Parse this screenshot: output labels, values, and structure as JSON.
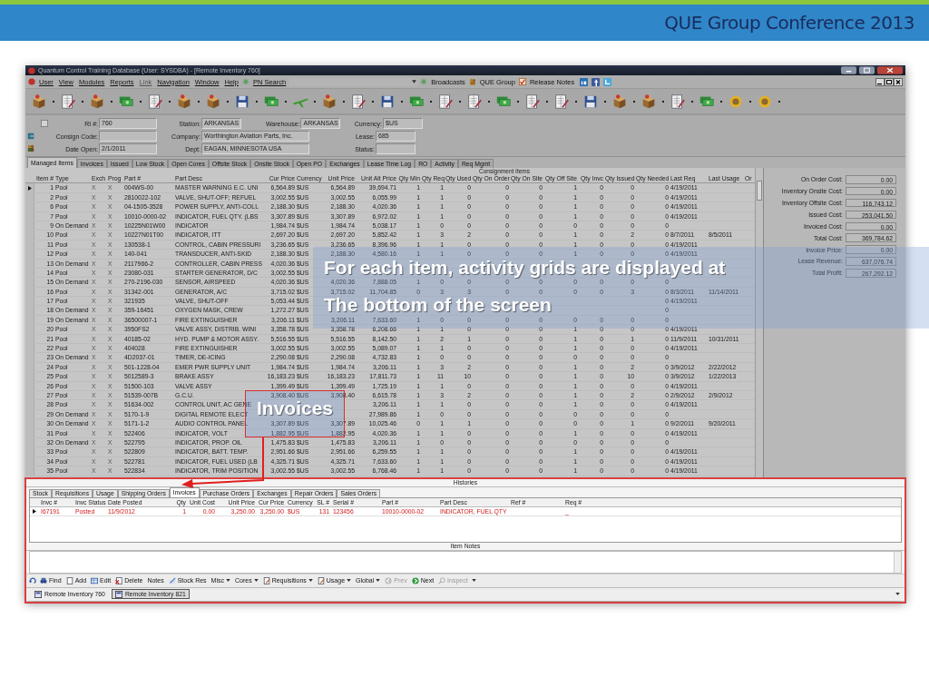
{
  "slide": {
    "title": "QUE Group Conference 2013"
  },
  "window": {
    "title": "Quantum Control Training Database (User: SYSDBA) - [Remote Inventory 760]",
    "menu": [
      {
        "label": "User",
        "disabled": false
      },
      {
        "label": "View",
        "disabled": false
      },
      {
        "label": "Modules",
        "disabled": false
      },
      {
        "label": "Reports",
        "disabled": false
      },
      {
        "label": "Link",
        "disabled": true
      },
      {
        "label": "Navigation",
        "disabled": false
      },
      {
        "label": "Window",
        "disabled": false
      },
      {
        "label": "Help",
        "disabled": false
      }
    ],
    "pn_search": "PN Search",
    "links": [
      "Broadcasts",
      "QUE Group",
      "Release Notes"
    ]
  },
  "form": {
    "checkbox": {
      "checked": false
    },
    "rows": [
      [
        {
          "label": "RI #:",
          "value": "760"
        },
        {
          "label": "Station:",
          "value": "ARKANSAS"
        },
        {
          "label": "Warehouse:",
          "value": "ARKANSAS"
        },
        {
          "label": "Currency:",
          "value": "$US"
        }
      ],
      [
        {
          "label": "Consign Code:"
        },
        {
          "label": "Company:",
          "value": "Worthington Aviation Parts, Inc."
        },
        {
          "label": "Lease:",
          "value": "685"
        }
      ],
      [
        {
          "label": "Date Open:",
          "value": "2/1/2011"
        },
        {
          "label": "Dept:",
          "value": "EAGAN, MINNESOTA USA"
        },
        {
          "label": "Status:"
        }
      ]
    ]
  },
  "tabs": [
    {
      "label": "Managed Items",
      "selected": true
    },
    {
      "label": "Invoices",
      "selected": false
    },
    {
      "label": "Issued",
      "selected": false
    },
    {
      "label": "Low Stock",
      "selected": false
    },
    {
      "label": "Open Cores",
      "selected": false
    },
    {
      "label": "Offsite Stock",
      "selected": false
    },
    {
      "label": "Onsite Stock",
      "selected": false
    },
    {
      "label": "Open PO",
      "selected": false
    },
    {
      "label": "Exchanges",
      "selected": false
    },
    {
      "label": "Lease Time Log",
      "selected": false
    },
    {
      "label": "RO",
      "selected": false
    },
    {
      "label": "Activity",
      "selected": false
    },
    {
      "label": "Req Mgmt",
      "selected": false
    }
  ],
  "grid": {
    "group_header": "Consignment Items",
    "columns": [
      "Item #",
      "Type",
      "Exch",
      "Prog",
      "Part #",
      "Part Desc",
      "Cur Price",
      "Currency",
      "Unit Price",
      "Unit Alt Price",
      "Qty Min",
      "Qty Req",
      "Qty Used",
      "Qty On Order",
      "Qty On Site",
      "Qty Off Site",
      "Qty Invc",
      "Qty Issued",
      "Qty Needed",
      "Last Req",
      "Last Usage",
      "Or"
    ],
    "rows": [
      {
        "selected": true,
        "cells": [
          "1",
          "Pool",
          "X",
          "X",
          "004WS-00",
          "MASTER WARNING E.C. UNI",
          "6,564.89",
          "$US",
          "6,564.89",
          "39,694.71",
          "1",
          "1",
          "0",
          "0",
          "0",
          "1",
          "0",
          "0",
          "0",
          "4/19/2011",
          null
        ]
      },
      {
        "selected": false,
        "cells": [
          "2",
          "Pool",
          "X",
          "X",
          "2810022-102",
          "VALVE, SHUT-OFF; REFUEL",
          "3,002.55",
          "$US",
          "3,002.55",
          "6,055.99",
          "1",
          "1",
          "0",
          "0",
          "0",
          "1",
          "0",
          "0",
          "0",
          "4/19/2011",
          null
        ]
      },
      {
        "selected": false,
        "cells": [
          "6",
          "Pool",
          "X",
          "X",
          "04-1505-3528",
          "POWER SUPPLY, ANTI-COLL",
          "2,188.30",
          "$US",
          "2,188.30",
          "4,020.36",
          "1",
          "1",
          "0",
          "0",
          "0",
          "1",
          "0",
          "0",
          "0",
          "4/19/2011",
          null
        ]
      },
      {
        "selected": false,
        "cells": [
          "7",
          "Pool",
          "X",
          "X",
          "10010-0000-02",
          "INDICATOR, FUEL QTY. (LBS",
          "3,307.89",
          "$US",
          "3,307.89",
          "6,972.02",
          "1",
          "1",
          "0",
          "0",
          "0",
          "1",
          "0",
          "0",
          "0",
          "4/19/2011",
          null
        ]
      },
      {
        "selected": false,
        "cells": [
          "9",
          "On Demand",
          "X",
          "X",
          "10225N01W00",
          "INDICATOR",
          "1,984.74",
          "$US",
          "1,984.74",
          "5,038.17",
          "1",
          "0",
          "0",
          "0",
          "0",
          "0",
          "0",
          "0",
          "0",
          null,
          null
        ]
      },
      {
        "selected": false,
        "cells": [
          "10",
          "Pool",
          "X",
          "X",
          "10227N01T00",
          "INDICATOR, ITT",
          "2,697.20",
          "$US",
          "2,697.20",
          "5,852.42",
          "1",
          "3",
          "2",
          "0",
          "0",
          "1",
          "0",
          "2",
          "0",
          "8/7/2011",
          "8/5/2011"
        ]
      },
      {
        "selected": false,
        "cells": [
          "11",
          "Pool",
          "X",
          "X",
          "130538-1",
          "CONTROL, CABIN PRESSURI",
          "3,236.65",
          "$US",
          "3,236.65",
          "8,396.96",
          "1",
          "1",
          "0",
          "0",
          "0",
          "1",
          "0",
          "0",
          "0",
          "4/19/2011",
          null
        ]
      },
      {
        "selected": false,
        "cells": [
          "12",
          "Pool",
          "X",
          "X",
          "140-041",
          "TRANSDUCER, ANTI-SKID",
          "2,188.30",
          "$US",
          "2,188.30",
          "4,580.16",
          "1",
          "1",
          "0",
          "0",
          "0",
          "1",
          "0",
          "0",
          "0",
          "4/19/2011",
          null
        ]
      },
      {
        "selected": false,
        "cells": [
          "13",
          "On Demand",
          "X",
          "X",
          "2117966-2",
          "CONTROLLER, CABIN PRESS",
          "4,020.36",
          "$US",
          null,
          null,
          null,
          null,
          null,
          null,
          null,
          null,
          null,
          null,
          null,
          null,
          null
        ]
      },
      {
        "selected": false,
        "cells": [
          "14",
          "Pool",
          "X",
          "X",
          "23080-031",
          "STARTER GENERATOR, D/C",
          "3,002.55",
          "$US",
          null,
          null,
          null,
          null,
          null,
          null,
          null,
          null,
          null,
          null,
          null,
          null,
          null
        ]
      },
      {
        "selected": false,
        "cells": [
          "15",
          "On Demand",
          "X",
          "X",
          "270-2196-030",
          "SENSOR, AIRSPEED",
          "4,020.36",
          "$US",
          "4,020.36",
          "7,888.05",
          "1",
          "0",
          "0",
          "0",
          "0",
          "0",
          "0",
          "0",
          "0",
          null,
          null
        ]
      },
      {
        "selected": false,
        "cells": [
          "16",
          "Pool",
          "X",
          "X",
          "31342-001",
          "GENERATOR, A/C",
          "3,715.02",
          "$US",
          "3,715.02",
          "11,704.85",
          "0",
          "3",
          "3",
          "0",
          "0",
          "0",
          "0",
          "3",
          "0",
          "8/3/2011",
          "11/14/2011"
        ]
      },
      {
        "selected": false,
        "cells": [
          "17",
          "Pool",
          "X",
          "X",
          "321935",
          "VALVE, SHUT-OFF",
          "5,053.44",
          "$US",
          null,
          null,
          null,
          null,
          null,
          null,
          null,
          null,
          null,
          null,
          "0",
          "4/19/2011",
          null
        ]
      },
      {
        "selected": false,
        "cells": [
          "18",
          "On Demand",
          "X",
          "X",
          "359-16451",
          "OXYGEN MASK, CREW",
          "1,272.27",
          "$US",
          null,
          null,
          null,
          null,
          null,
          null,
          null,
          null,
          null,
          null,
          "0",
          null,
          null
        ]
      },
      {
        "selected": false,
        "cells": [
          "19",
          "On Demand",
          "X",
          "X",
          "36500007-1",
          "FIRE EXTINGUISHER",
          "3,206.11",
          "$US",
          "3,206.11",
          "7,633.60",
          "1",
          "0",
          "0",
          "0",
          "0",
          "0",
          "0",
          "0",
          "0",
          null,
          null
        ]
      },
      {
        "selected": false,
        "cells": [
          "20",
          "Pool",
          "X",
          "X",
          "3950FS2",
          "VALVE ASSY,  DISTRIB. WINI",
          "3,358.78",
          "$US",
          "3,358.78",
          "6,208.66",
          "1",
          "1",
          "0",
          "0",
          "0",
          "1",
          "0",
          "0",
          "0",
          "4/19/2011",
          null
        ]
      },
      {
        "selected": false,
        "cells": [
          "21",
          "Pool",
          "X",
          "X",
          "40185-02",
          "HYD. PUMP & MOTOR ASSY.",
          "5,516.55",
          "$US",
          "5,516.55",
          "8,142.50",
          "1",
          "2",
          "1",
          "0",
          "0",
          "1",
          "0",
          "1",
          "0",
          "11/9/2011",
          "10/31/2011"
        ]
      },
      {
        "selected": false,
        "cells": [
          "22",
          "Pool",
          "X",
          "X",
          "404028",
          "FIRE EXTINGUISHER",
          "3,002.55",
          "$US",
          "3,002.55",
          "5,089.07",
          "1",
          "1",
          "0",
          "0",
          "0",
          "1",
          "0",
          "0",
          "0",
          "4/19/2011",
          null
        ]
      },
      {
        "selected": false,
        "cells": [
          "23",
          "On Demand",
          "X",
          "X",
          "4D2037-01",
          "TIMER, DE-ICING",
          "2,290.08",
          "$US",
          "2,290.08",
          "4,732.83",
          "1",
          "0",
          "0",
          "0",
          "0",
          "0",
          "0",
          "0",
          "0",
          null,
          null
        ]
      },
      {
        "selected": false,
        "cells": [
          "24",
          "Pool",
          "X",
          "X",
          "501-1228-04",
          "EMER PWR SUPPLY UNIT",
          "1,984.74",
          "$US",
          "1,984.74",
          "3,206.11",
          "1",
          "3",
          "2",
          "0",
          "0",
          "1",
          "0",
          "2",
          "0",
          "3/9/2012",
          "2/22/2012"
        ]
      },
      {
        "selected": false,
        "cells": [
          "25",
          "Pool",
          "X",
          "X",
          "5012589-3",
          "BRAKE ASSY",
          "16,183.23",
          "$US",
          "16,183.23",
          "17,811.73",
          "1",
          "11",
          "10",
          "0",
          "0",
          "1",
          "0",
          "10",
          "0",
          "3/9/2012",
          "1/22/2013"
        ]
      },
      {
        "selected": false,
        "cells": [
          "26",
          "Pool",
          "X",
          "X",
          "51500-103",
          "VALVE ASSY",
          "1,399.49",
          "$US",
          "1,399.49",
          "1,725.19",
          "1",
          "1",
          "0",
          "0",
          "0",
          "1",
          "0",
          "0",
          "0",
          "4/19/2011",
          null
        ]
      },
      {
        "selected": false,
        "cells": [
          "27",
          "Pool",
          "X",
          "X",
          "51539-007B",
          "G.C.U.",
          "3,908.40",
          "$US",
          "3,908.40",
          "6,615.78",
          "1",
          "3",
          "2",
          "0",
          "0",
          "1",
          "0",
          "2",
          "0",
          "2/9/2012",
          "2/9/2012"
        ]
      },
      {
        "selected": false,
        "cells": [
          "28",
          "Pool",
          "X",
          "X",
          "51634-002",
          "CONTROL UNIT, AC GENE",
          null,
          null,
          null,
          "3,206.11",
          "1",
          "1",
          "0",
          "0",
          "0",
          "1",
          "0",
          "0",
          "0",
          "4/19/2011",
          null
        ]
      },
      {
        "selected": false,
        "cells": [
          "29",
          "On Demand",
          "X",
          "X",
          "5170-1-9",
          "DIGITAL REMOTE ELECT",
          null,
          null,
          null,
          "27,989.86",
          "1",
          "0",
          "0",
          "0",
          "0",
          "0",
          "0",
          "0",
          "0",
          null,
          null
        ]
      },
      {
        "selected": false,
        "cells": [
          "30",
          "On Demand",
          "X",
          "X",
          "5171-1-2",
          "AUDIO CONTROL PANEL",
          "3,307.89",
          "$US",
          "3,307.89",
          "10,025.46",
          "0",
          "1",
          "1",
          "0",
          "0",
          "0",
          "0",
          "1",
          "0",
          "9/2/2011",
          "9/20/2011"
        ]
      },
      {
        "selected": false,
        "cells": [
          "31",
          "Pool",
          "X",
          "X",
          "522406",
          "INDICATOR, VOLT",
          "1,882.95",
          "$US",
          "1,882.95",
          "4,020.36",
          "1",
          "1",
          "0",
          "0",
          "0",
          "1",
          "0",
          "0",
          "0",
          "4/19/2011",
          null
        ]
      },
      {
        "selected": false,
        "cells": [
          "32",
          "On Demand",
          "X",
          "X",
          "522795",
          "INDICATOR, PROP. OIL",
          "1,475.83",
          "$US",
          "1,475.83",
          "3,206.11",
          "1",
          "0",
          "0",
          "0",
          "0",
          "0",
          "0",
          "0",
          "0",
          null,
          null
        ]
      },
      {
        "selected": false,
        "cells": [
          "33",
          "Pool",
          "X",
          "X",
          "522809",
          "INDICATOR, BATT. TEMP.",
          "2,951.66",
          "$US",
          "2,951.66",
          "6,259.55",
          "1",
          "1",
          "0",
          "0",
          "0",
          "1",
          "0",
          "0",
          "0",
          "4/19/2011",
          null
        ]
      },
      {
        "selected": false,
        "cells": [
          "34",
          "Pool",
          "X",
          "X",
          "522781",
          "INDICATOR, FUEL USED (LB",
          "4,325.71",
          "$US",
          "4,325.71",
          "7,633.60",
          "1",
          "1",
          "0",
          "0",
          "0",
          "1",
          "0",
          "0",
          "0",
          "4/19/2011",
          null
        ]
      },
      {
        "selected": false,
        "cells": [
          "35",
          "Pool",
          "X",
          "X",
          "522834",
          "INDICATOR, TRIM POSITION",
          "3,002.55",
          "$US",
          "3,002.55",
          "6,768.46",
          "1",
          "1",
          "0",
          "0",
          "0",
          "1",
          "0",
          "0",
          "0",
          "4/19/2011",
          null
        ]
      }
    ]
  },
  "costs": [
    {
      "label": "On Order Cost:",
      "value": "0.00"
    },
    {
      "label": "Inventory Onsite Cost:",
      "value": "0.00"
    },
    {
      "label": "Inventory Offsite Cost:",
      "value": "116,743.12"
    },
    {
      "label": "Issued Cost:",
      "value": "253,041.50"
    },
    {
      "label": "Invoiced Cost:",
      "value": "0.00"
    },
    {
      "label": "Total Cost:",
      "value": "369,784.62"
    },
    {
      "label": "Invoice Price:",
      "value": "0.00"
    },
    {
      "label": "Lease Revenue:",
      "value": "637,076.74"
    },
    {
      "label": "Total Profit:",
      "value": "267,292.12"
    }
  ],
  "histories": {
    "title": "Histories",
    "tabs": [
      {
        "label": "Stock",
        "selected": false
      },
      {
        "label": "Requisitions",
        "selected": false
      },
      {
        "label": "Usage",
        "selected": false
      },
      {
        "label": "Shipping Orders",
        "selected": false
      },
      {
        "label": "Invoices",
        "selected": true
      },
      {
        "label": "Purchase Orders",
        "selected": false
      },
      {
        "label": "Exchanges",
        "selected": false
      },
      {
        "label": "Repair Orders",
        "selected": false
      },
      {
        "label": "Sales Orders",
        "selected": false
      }
    ],
    "columns": [
      "Invc #",
      "Invc Status",
      "Date Posted",
      "Qty",
      "Unit Cost",
      "Unit Price",
      "Cur Price",
      "Currency",
      "SL #",
      "Serial #",
      "Part #",
      "Part Desc",
      "Ref #",
      "Req #"
    ],
    "rows": [
      {
        "selected": true,
        "cells": [
          "I67191",
          "Posted",
          "11/9/2012",
          "1",
          "0.00",
          "3,250.00",
          "3,250.00",
          "$US",
          "131",
          "123456",
          "10010-0000-02",
          "INDICATOR, FUEL QTY",
          null,
          "_"
        ]
      }
    ],
    "notes_title": "Item Notes"
  },
  "toolbar": [
    {
      "label": "Find",
      "kind": "button",
      "disabled": false
    },
    {
      "label": "Add",
      "kind": "button",
      "disabled": false
    },
    {
      "label": "Edit",
      "kind": "button",
      "disabled": false
    },
    {
      "label": "Delete",
      "kind": "button",
      "disabled": false
    },
    {
      "label": "Notes",
      "kind": "button",
      "disabled": false
    },
    {
      "label": "Stock Res",
      "kind": "button",
      "disabled": false
    },
    {
      "label": "Misc",
      "kind": "menu",
      "disabled": false
    },
    {
      "label": "Cores",
      "kind": "menu",
      "disabled": false
    },
    {
      "label": "Requisitions",
      "kind": "menu",
      "disabled": false
    },
    {
      "label": "Usage",
      "kind": "menu",
      "disabled": false
    },
    {
      "label": "Global",
      "kind": "menu",
      "disabled": false
    },
    {
      "label": "Prev",
      "kind": "button",
      "disabled": true
    },
    {
      "label": "Next",
      "kind": "button",
      "disabled": false
    },
    {
      "label": "Inspect",
      "kind": "button",
      "disabled": true
    }
  ],
  "window_tabs": [
    {
      "label": "Remote Inventory 760",
      "selected": false
    },
    {
      "label": "Remote Inventory 821",
      "selected": true
    }
  ],
  "callouts": [
    {
      "kind": "banner",
      "lines": [
        "For each item, activity grids are displayed at",
        "The bottom of the screen"
      ]
    },
    {
      "kind": "box",
      "lines": [
        "Invoices"
      ]
    }
  ]
}
